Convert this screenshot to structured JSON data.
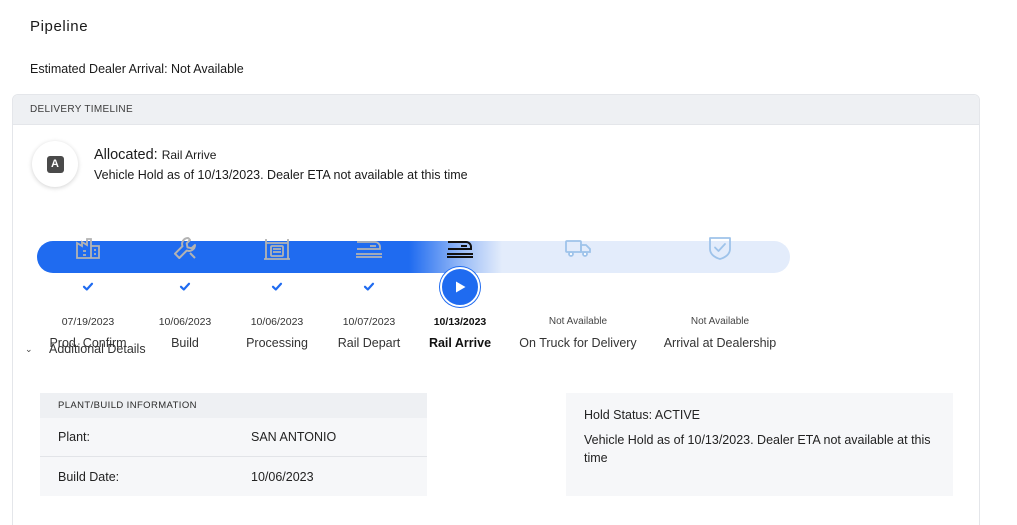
{
  "page": {
    "title": "Pipeline",
    "eta_text": "Estimated Dealer Arrival: Not Available"
  },
  "card": {
    "header": "DELIVERY TIMELINE",
    "status": {
      "badge_letter": "A",
      "heading": "Allocated:",
      "subheading": "Rail Arrive",
      "description": "Vehicle Hold as of 10/13/2023. Dealer ETA not available at this time"
    },
    "progress": {
      "completed_stages": 4,
      "current_stage_index": 4,
      "total_stages": 7
    },
    "stages": [
      {
        "label": "Prod. Confirm",
        "date": "07/19/2023",
        "state": "done",
        "icon": "factory-icon"
      },
      {
        "label": "Build",
        "date": "10/06/2023",
        "state": "done",
        "icon": "wrench-icon"
      },
      {
        "label": "Processing",
        "date": "10/06/2023",
        "state": "done",
        "icon": "processing-icon"
      },
      {
        "label": "Rail Depart",
        "date": "10/07/2023",
        "state": "done",
        "icon": "rail-depart-icon"
      },
      {
        "label": "Rail Arrive",
        "date": "10/13/2023",
        "state": "current",
        "icon": "rail-arrive-icon"
      },
      {
        "label": "On Truck for Delivery",
        "date": "Not Available",
        "state": "pending",
        "icon": "truck-icon"
      },
      {
        "label": "Arrival at Dealership",
        "date": "Not Available",
        "state": "pending",
        "icon": "shield-check-icon"
      }
    ],
    "details": {
      "toggle_label": "Additional Details",
      "plant": {
        "header": "PLANT/BUILD INFORMATION",
        "rows": [
          {
            "key": "Plant:",
            "value": "SAN ANTONIO"
          },
          {
            "key": "Build Date:",
            "value": "10/06/2023"
          }
        ]
      },
      "hold": {
        "status": "Hold Status: ACTIVE",
        "message": "Vehicle Hold as of 10/13/2023. Dealer ETA not available at this time"
      }
    }
  },
  "colors": {
    "accent": "#1f6bf0",
    "track": "#e3ecfb",
    "done_icon": "#b3b3b3",
    "pending_icon": "#9ec3ea"
  }
}
